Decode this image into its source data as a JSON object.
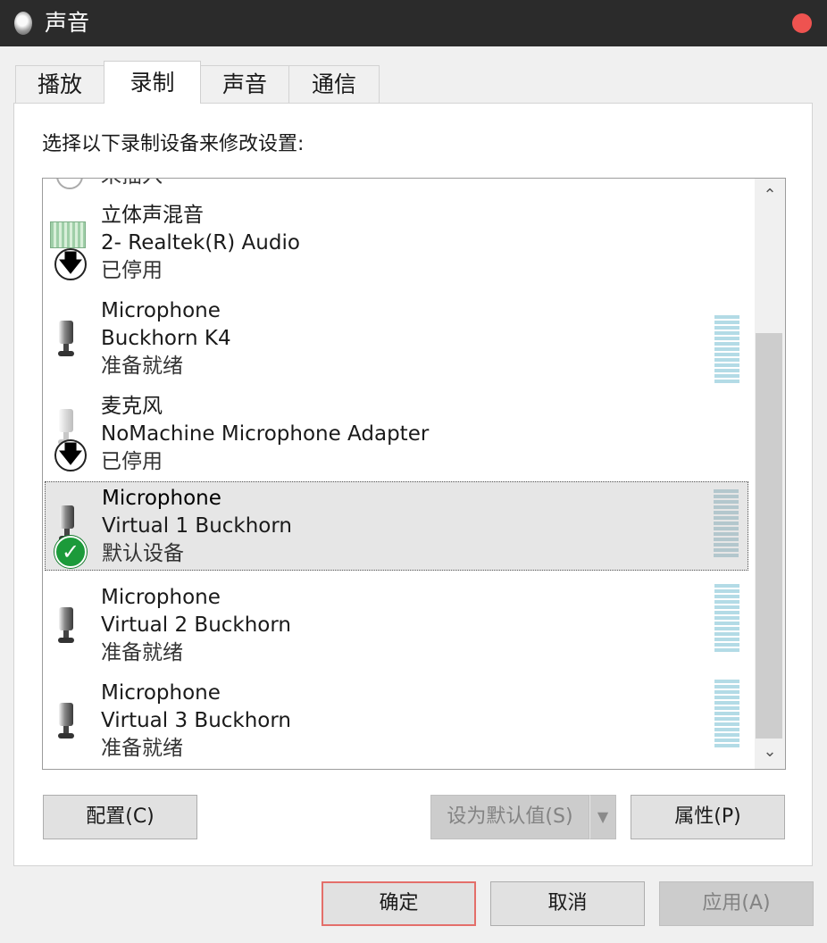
{
  "window": {
    "title": "声音"
  },
  "tabs": [
    {
      "label": "播放",
      "active": false
    },
    {
      "label": "录制",
      "active": true
    },
    {
      "label": "声音",
      "active": false
    },
    {
      "label": "通信",
      "active": false
    }
  ],
  "instruction": "选择以下录制设备来修改设置:",
  "devices": [
    {
      "name": "立体声混音",
      "device": "2- Realtek(R) Audio",
      "status": "已停用",
      "icon": "sound-card-icon",
      "badge": "disabled-arrow-icon"
    },
    {
      "name": "Microphone",
      "device": "Buckhorn K4",
      "status": "准备就绪",
      "icon": "microphone-icon"
    },
    {
      "name": "麦克风",
      "device": "NoMachine Microphone Adapter",
      "status": "已停用",
      "icon": "microphone-icon",
      "badge": "disabled-arrow-icon"
    },
    {
      "name": "Microphone",
      "device": "Virtual 1 Buckhorn",
      "status": "默认设备",
      "icon": "microphone-icon",
      "badge": "default-check-icon",
      "selected": true
    },
    {
      "name": "Microphone",
      "device": "Virtual 2 Buckhorn",
      "status": "准备就绪",
      "icon": "microphone-icon"
    },
    {
      "name": "Microphone",
      "device": "Virtual 3 Buckhorn",
      "status": "准备就绪",
      "icon": "microphone-icon"
    }
  ],
  "buttons": {
    "configure": "配置(C)",
    "set_default": "设为默认值(S)",
    "properties": "属性(P)",
    "ok": "确定",
    "cancel": "取消",
    "apply": "应用(A)"
  },
  "colors": {
    "titlebar": "#2b2b2b",
    "close": "#ee5350",
    "default_check": "#1c9a3a",
    "level_meter": "#b3dbe6"
  }
}
